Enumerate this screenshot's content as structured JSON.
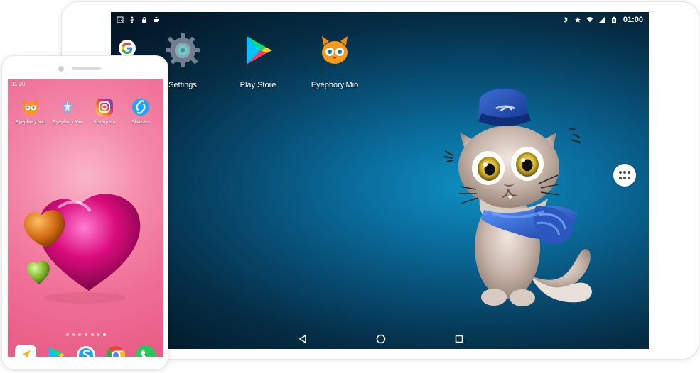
{
  "tablet": {
    "status_time": "01:00",
    "apps": [
      {
        "label": "Settings",
        "icon": "settings-icon"
      },
      {
        "label": "Play Store",
        "icon": "play-store-icon"
      },
      {
        "label": "Eyephory.Mio",
        "icon": "eyephory-mio-icon"
      }
    ],
    "google_icon": "google-icon",
    "overflow_icon": "more-apps-icon",
    "nav_icons": [
      "back-icon",
      "home-icon",
      "recents-icon"
    ],
    "wallpaper_subject": "cat-illustration"
  },
  "phone": {
    "status_time": "11:30",
    "apps": [
      {
        "label": "Eyephory.Mio",
        "icon": "eyephory-mio-icon"
      },
      {
        "label": "Eyephory.Mix",
        "icon": "eyephory-mix-icon"
      },
      {
        "label": "Instagram",
        "icon": "instagram-icon"
      },
      {
        "label": "Shazam",
        "icon": "shazam-icon"
      }
    ],
    "dock_icons": [
      "navigation-icon",
      "play-store-icon",
      "skype-icon",
      "chrome-icon",
      "phone-icon"
    ],
    "page_indicator": {
      "pages": 7,
      "active": 7
    },
    "wallpaper_subject": "hearts-wallpaper"
  },
  "colors": {
    "tablet_background": "#0a6f9f",
    "phone_background": "#ef6f96",
    "accent_blue": "#2563c8",
    "white": "#ffffff"
  }
}
